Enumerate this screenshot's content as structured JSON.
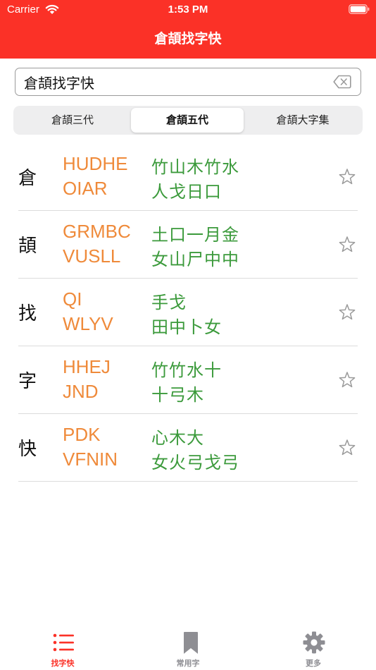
{
  "colors": {
    "nav_red": "#fb3127",
    "code_orange": "#ef8a3a",
    "radical_green": "#3b9a3b",
    "tab_active": "#fb3127",
    "tab_inactive": "#8e8e93"
  },
  "status_bar": {
    "carrier": "Carrier",
    "time": "1:53 PM"
  },
  "nav": {
    "title": "倉頡找字快"
  },
  "search": {
    "value": "倉頡找字快",
    "clear_icon": "delete-left-icon"
  },
  "segments": [
    {
      "label": "倉頡三代",
      "selected": false
    },
    {
      "label": "倉頡五代",
      "selected": true
    },
    {
      "label": "倉頡大字集",
      "selected": false
    }
  ],
  "results": [
    {
      "char": "倉",
      "code1": "HUDHE",
      "radicals1": "竹山木竹水",
      "code2": "OIAR",
      "radicals2": "人戈日口"
    },
    {
      "char": "頡",
      "code1": "GRMBC",
      "radicals1": "土口一月金",
      "code2": "VUSLL",
      "radicals2": "女山尸中中"
    },
    {
      "char": "找",
      "code1": "QI",
      "radicals1": "手戈",
      "code2": "WLYV",
      "radicals2": "田中卜女"
    },
    {
      "char": "字",
      "code1": "HHEJ",
      "radicals1": "竹竹水十",
      "code2": "JND",
      "radicals2": "十弓木"
    },
    {
      "char": "快",
      "code1": "PDK",
      "radicals1": "心木大",
      "code2": "VFNIN",
      "radicals2": "女火弓戈弓"
    }
  ],
  "tabs": [
    {
      "label": "找字快",
      "icon": "list-icon",
      "active": true
    },
    {
      "label": "常用字",
      "icon": "bookmark-icon",
      "active": false
    },
    {
      "label": "更多",
      "icon": "gear-icon",
      "active": false
    }
  ]
}
